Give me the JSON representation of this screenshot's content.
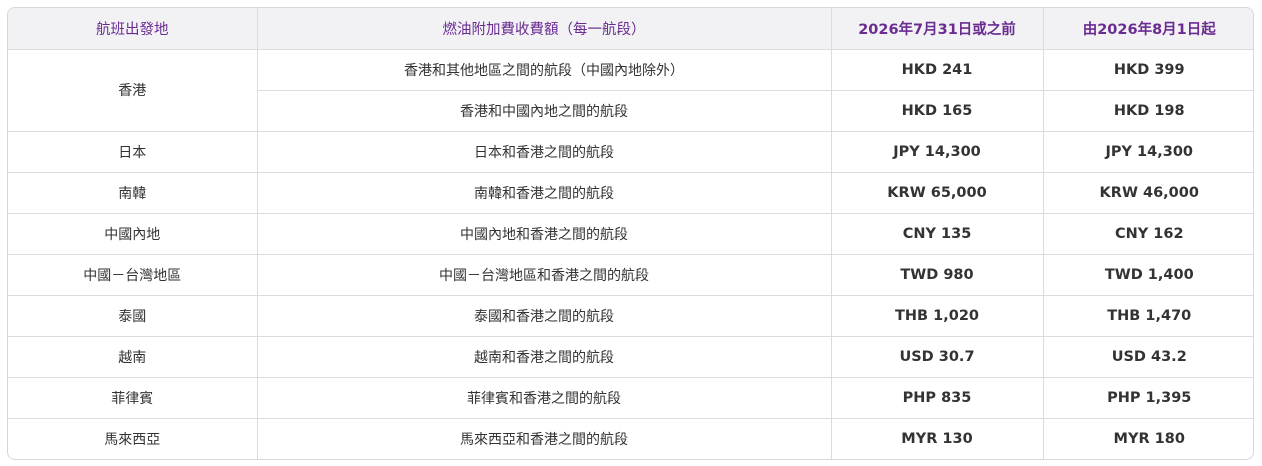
{
  "table": {
    "headers": {
      "origin": "航班出發地",
      "surcharge": "燃油附加費收費額（每一航段）",
      "before": "2026年7月31日或之前",
      "after": "由2026年8月1日起"
    },
    "hongkong": {
      "origin": "香港",
      "rows": [
        {
          "segment": "香港和其他地區之間的航段（中國內地除外）",
          "before": "HKD 241",
          "after": "HKD 399"
        },
        {
          "segment": "香港和中國內地之間的航段",
          "before": "HKD 165",
          "after": "HKD 198"
        }
      ]
    },
    "rows": [
      {
        "origin": "日本",
        "segment": "日本和香港之間的航段",
        "before": "JPY 14,300",
        "after": "JPY 14,300"
      },
      {
        "origin": "南韓",
        "segment": "南韓和香港之間的航段",
        "before": "KRW 65,000",
        "after": "KRW 46,000"
      },
      {
        "origin": "中國內地",
        "segment": "中國內地和香港之間的航段",
        "before": "CNY 135",
        "after": "CNY 162"
      },
      {
        "origin": "中國－台灣地區",
        "segment": "中國－台灣地區和香港之間的航段",
        "before": "TWD 980",
        "after": "TWD 1,400"
      },
      {
        "origin": "泰國",
        "segment": "泰國和香港之間的航段",
        "before": "THB 1,020",
        "after": "THB 1,470"
      },
      {
        "origin": "越南",
        "segment": "越南和香港之間的航段",
        "before": "USD 30.7",
        "after": "USD 43.2"
      },
      {
        "origin": "菲律賓",
        "segment": "菲律賓和香港之間的航段",
        "before": "PHP 835",
        "after": "PHP 1,395"
      },
      {
        "origin": "馬來西亞",
        "segment": "馬來西亞和香港之間的航段",
        "before": "MYR 130",
        "after": "MYR 180"
      }
    ]
  }
}
